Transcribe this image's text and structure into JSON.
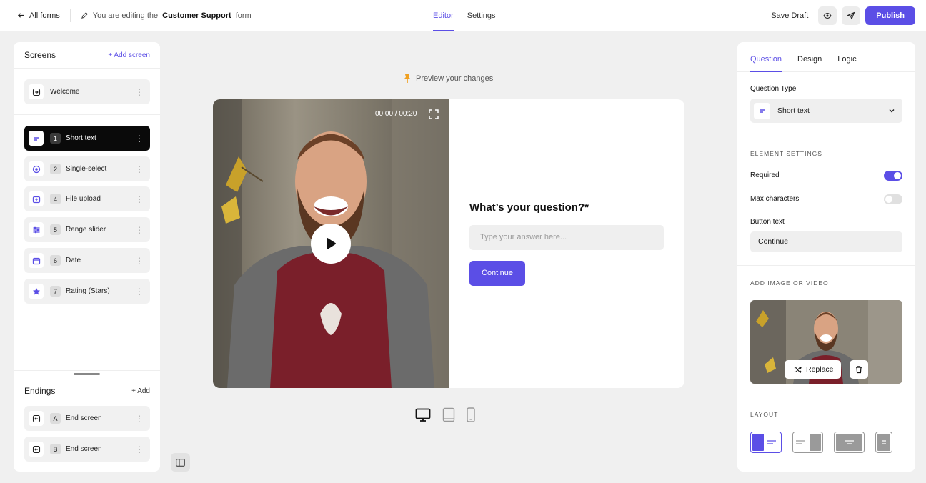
{
  "topbar": {
    "back_label": "All forms",
    "editing_prefix": "You are editing the",
    "form_name": "Customer Support",
    "editing_suffix": "form",
    "tabs": [
      {
        "label": "Editor",
        "active": true
      },
      {
        "label": "Settings",
        "active": false
      }
    ],
    "save_draft": "Save Draft",
    "publish": "Publish"
  },
  "sidebar": {
    "screens_title": "Screens",
    "add_screen": "Add screen",
    "welcome": {
      "label": "Welcome",
      "icon": "enter-icon"
    },
    "items": [
      {
        "num": "1",
        "label": "Short text",
        "icon": "short-text-icon",
        "active": true
      },
      {
        "num": "2",
        "label": "Single-select",
        "icon": "radio-icon"
      },
      {
        "num": "4",
        "label": "File upload",
        "icon": "upload-icon"
      },
      {
        "num": "5",
        "label": "Range slider",
        "icon": "sliders-icon"
      },
      {
        "num": "6",
        "label": "Date",
        "icon": "calendar-icon"
      },
      {
        "num": "7",
        "label": "Rating (Stars)",
        "icon": "star-icon"
      }
    ],
    "endings_title": "Endings",
    "add_ending": "Add",
    "endings": [
      {
        "num": "A",
        "label": "End screen",
        "icon": "exit-icon"
      },
      {
        "num": "B",
        "label": "End screen",
        "icon": "exit-icon"
      }
    ]
  },
  "preview": {
    "hint": "Preview your changes",
    "timecode": "00:00 / 00:20",
    "question": "What’s your question?",
    "required_mark": "*",
    "answer_placeholder": "Type your answer here...",
    "continue": "Continue",
    "devices": [
      "desktop-icon",
      "tablet-icon",
      "mobile-icon"
    ]
  },
  "inspector": {
    "tabs": [
      {
        "label": "Question",
        "active": true
      },
      {
        "label": "Design"
      },
      {
        "label": "Logic"
      }
    ],
    "question_type_label": "Question Type",
    "question_type_value": "Short text",
    "element_settings": "ELEMENT SETTINGS",
    "required_label": "Required",
    "required_on": true,
    "max_chars_label": "Max characters",
    "max_chars_on": false,
    "button_text_label": "Button text",
    "button_text_value": "Continue",
    "media_section": "ADD IMAGE OR VIDEO",
    "replace": "Replace",
    "layout_section": "LAYOUT",
    "layouts": [
      "media-left",
      "media-right",
      "media-background",
      "no-media"
    ],
    "selected_layout": "media-left"
  },
  "colors": {
    "accent": "#5b4ee6",
    "amber": "#f0a020",
    "shirt": "#7a1f2a"
  }
}
